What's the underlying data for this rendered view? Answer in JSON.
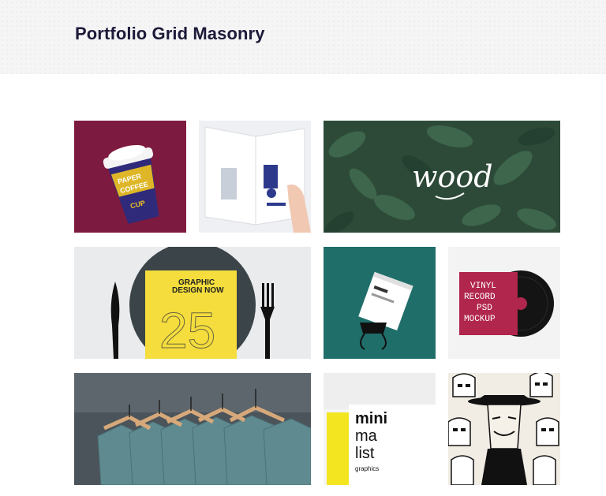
{
  "page": {
    "title": "Portfolio Grid Masonry"
  },
  "portfolio": {
    "items": [
      {
        "id": "coffee-cup",
        "text": [
          "PAPER",
          "COFFEE",
          "CUP"
        ],
        "bg": "#7d1a3f"
      },
      {
        "id": "magazine",
        "bg": "#eef0f3"
      },
      {
        "id": "wood",
        "text": [
          "wood"
        ],
        "bg": "#2d4a38"
      },
      {
        "id": "graphic-design-book",
        "text": [
          "GRAPHIC",
          "DESIGN NOW",
          "25"
        ],
        "bg": "#e9ebed"
      },
      {
        "id": "business-card",
        "bg": "#1f6e6a"
      },
      {
        "id": "vinyl-record",
        "text": [
          "VINYL",
          "RECORD",
          "PSD",
          "MOCKUP"
        ],
        "bg": "#f3f3f3"
      },
      {
        "id": "t-shirts",
        "bg": "#4b545a"
      },
      {
        "id": "minimalist-book",
        "text": [
          "mini",
          "ma",
          "list",
          "graphics"
        ],
        "bg": "#eeeeee"
      },
      {
        "id": "stormtroopers",
        "bg": "#f1ece4"
      }
    ]
  }
}
